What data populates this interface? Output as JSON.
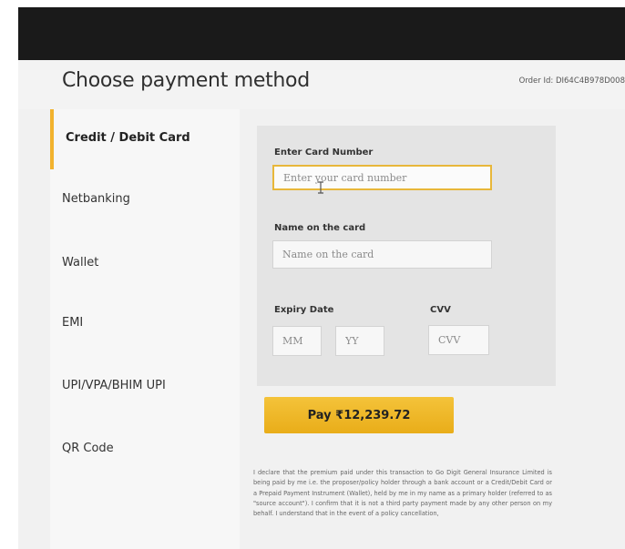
{
  "header": {
    "title": "Choose payment method",
    "order_id": "Order Id: DI64C4B978D008"
  },
  "sidebar": {
    "items": [
      {
        "label": "Credit / Debit Card",
        "active": true
      },
      {
        "label": "Netbanking",
        "active": false
      },
      {
        "label": "Wallet",
        "active": false
      },
      {
        "label": "EMI",
        "active": false
      },
      {
        "label": "UPI/VPA/BHIM UPI",
        "active": false
      },
      {
        "label": "QR Code",
        "active": false
      }
    ]
  },
  "card_form": {
    "card_number_label": "Enter Card Number",
    "card_number_placeholder": "Enter your card number",
    "name_label": "Name on the card",
    "name_placeholder": "Name on the card",
    "expiry_label": "Expiry Date",
    "month_placeholder": "MM",
    "year_placeholder": "YY",
    "cvv_label": "CVV",
    "cvv_placeholder": "CVV"
  },
  "pay_button": {
    "label": "Pay ₹12,239.72"
  },
  "declaration": "I declare that the premium paid under this transaction to Go Digit General Insurance Limited is being paid by me i.e. the proposer/policy holder through a bank account or a Credit/Debit Card or a Prepaid Payment Instrument (Wallet), held by me in my name as a primary holder (referred to as \"source account\"). I confirm that it is not a third party payment made by any other person on my behalf. I understand that in the event of a policy cancellation,",
  "colors": {
    "accent": "#f2b32e",
    "top_bar": "#1a1a1a",
    "panel": "#e4e4e4"
  }
}
